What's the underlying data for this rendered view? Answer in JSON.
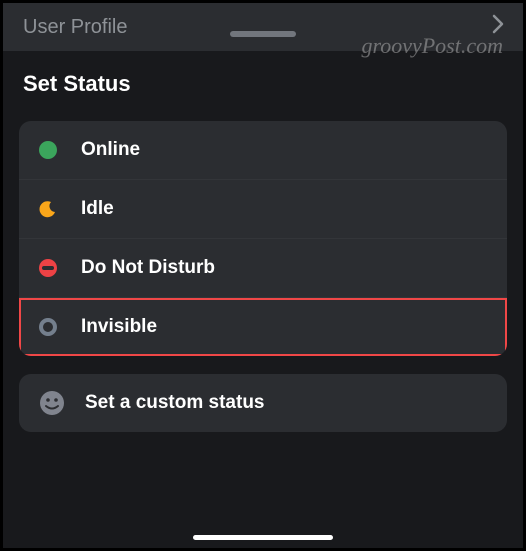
{
  "header": {
    "back_label": "User Profile"
  },
  "section_title": "Set Status",
  "statuses": [
    {
      "key": "online",
      "label": "Online"
    },
    {
      "key": "idle",
      "label": "Idle"
    },
    {
      "key": "dnd",
      "label": "Do Not Disturb"
    },
    {
      "key": "invisible",
      "label": "Invisible"
    }
  ],
  "highlighted_status": "invisible",
  "custom_status": {
    "label": "Set a custom status"
  },
  "watermark": "groovyPost.com",
  "colors": {
    "online": "#3ba55c",
    "idle": "#faa61a",
    "dnd": "#ed4245",
    "invisible": "#747f8d",
    "highlight": "#f04747"
  }
}
